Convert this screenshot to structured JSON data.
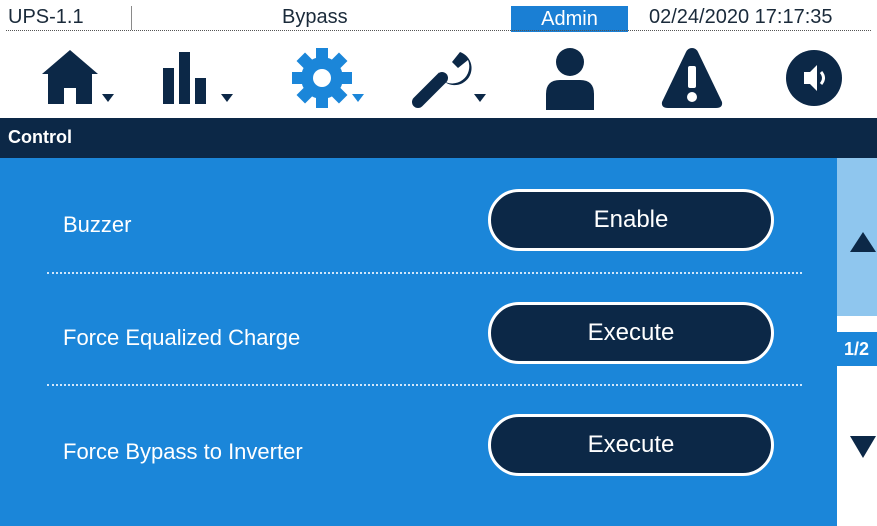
{
  "status": {
    "device": "UPS-1.1",
    "mode": "Bypass",
    "user": "Admin",
    "datetime": "02/24/2020  17:17:35"
  },
  "nav_icons": [
    "home-icon",
    "chart-bars-icon",
    "gear-icon",
    "wrench-icon",
    "user-icon",
    "alarm-warning-icon",
    "speaker-icon"
  ],
  "section": {
    "title": "Control"
  },
  "controls": [
    {
      "label": "Buzzer",
      "button": "Enable"
    },
    {
      "label": "Force Equalized Charge",
      "button": "Execute"
    },
    {
      "label": "Force Bypass to Inverter",
      "button": "Execute"
    }
  ],
  "pager": {
    "page": "1/2"
  },
  "colors": {
    "navy": "#0c2847",
    "panel_blue": "#1b86d9",
    "accent_blue": "#1a7fd4",
    "scroll_light": "#8fc6ee"
  }
}
